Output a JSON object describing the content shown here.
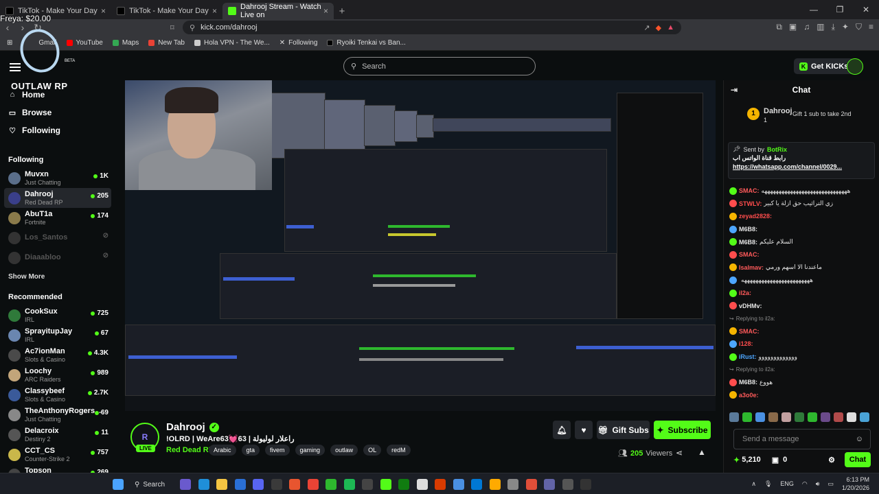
{
  "browser": {
    "tabs": [
      {
        "label": "TikTok - Make Your Day",
        "active": false
      },
      {
        "label": "TikTok - Make Your Day",
        "active": false
      },
      {
        "label": "Dahrooj Stream - Watch Live on",
        "active": true
      }
    ],
    "url": "kick.com/dahrooj",
    "overlay_text": "Freya: $20.00",
    "bookmarks": [
      "Gmail",
      "YouTube",
      "Maps",
      "New Tab",
      "Hola VPN - The We...",
      "Following",
      "Ryoiki Tenkai vs Ban..."
    ]
  },
  "logo": {
    "text": "OUTLAW RP",
    "beta": "BETA"
  },
  "header": {
    "search_placeholder": "Search",
    "get_kicks": "Get KICKs"
  },
  "sidebar": {
    "nav": [
      {
        "label": "Home",
        "icon": "home-icon"
      },
      {
        "label": "Browse",
        "icon": "browse-icon"
      },
      {
        "label": "Following",
        "icon": "heart-icon"
      }
    ],
    "following_title": "Following",
    "following": [
      {
        "name": "Muvxn",
        "category": "Just Chatting",
        "viewers": "1K",
        "online": true,
        "color": "#5a6e8a"
      },
      {
        "name": "Dahrooj",
        "category": "Red Dead RP",
        "viewers": "205",
        "online": true,
        "color": "#3a3f8a"
      },
      {
        "name": "AbuT1a",
        "category": "Fortnite",
        "viewers": "174",
        "online": true,
        "color": "#8a7a4a"
      },
      {
        "name": "Los_Santos",
        "category": "",
        "viewers": "",
        "online": false,
        "color": "#333"
      },
      {
        "name": "Diaaabloo",
        "category": "",
        "viewers": "",
        "online": false,
        "color": "#333"
      }
    ],
    "show_more": "Show More",
    "recommended_title": "Recommended",
    "recommended": [
      {
        "name": "CookSux",
        "category": "IRL",
        "viewers": "725",
        "color": "#2f7a3a"
      },
      {
        "name": "SprayitupJay",
        "category": "IRL",
        "viewers": "67",
        "color": "#6a86b0"
      },
      {
        "name": "Ac7ionMan",
        "category": "Slots & Casino",
        "viewers": "4.3K",
        "color": "#4a4a4a"
      },
      {
        "name": "Loochy",
        "category": "ARC Raiders",
        "viewers": "989",
        "color": "#c2a57a"
      },
      {
        "name": "Classybeef",
        "category": "Slots & Casino",
        "viewers": "2.7K",
        "color": "#3a5a9a"
      },
      {
        "name": "TheAnthonyRogers...",
        "category": "Just Chatting",
        "viewers": "69",
        "color": "#888"
      },
      {
        "name": "Delacroix",
        "category": "Destiny 2",
        "viewers": "11",
        "color": "#555"
      },
      {
        "name": "CCT_CS",
        "category": "Counter-Strike 2",
        "viewers": "757",
        "color": "#c9b74a"
      },
      {
        "name": "Topson",
        "category": "",
        "viewers": "269",
        "color": "#444"
      }
    ]
  },
  "stream": {
    "name": "Dahrooj",
    "title": "!OLRD | WeAre63💓63 | راعلار لوليولة",
    "category": "Red Dead RP",
    "tags": [
      "Arabic",
      "gta",
      "fivem",
      "gaming",
      "outlaw",
      "OL",
      "redM"
    ],
    "live_label": "LIVE",
    "gift_subs": "Gift Subs",
    "subscribe": "Subscribe",
    "viewers": "205",
    "viewers_label": "Viewers"
  },
  "chat": {
    "title": "Chat",
    "top_gifter": {
      "name": "Dahrooj",
      "count": "1",
      "gift_text": "Gift 1 sub to take 2nd"
    },
    "pinned": {
      "sent_by": "Sent by",
      "bot": "BotRix",
      "text": "رابط قناة الواتس اب",
      "link": "https://whatsapp.com/channel/0029..."
    },
    "messages": [
      {
        "user": "SMAC:",
        "text": "ههههههههههههههههههههههههههههههه",
        "color": "#ff5a5a",
        "reply": ""
      },
      {
        "user": "STWLV:",
        "text": "زي التراثيب حق ازلة يا كبير",
        "color": "#ff4d4d",
        "reply": ""
      },
      {
        "user": "zeyad2828:",
        "text": "",
        "color": "#ff4d4d",
        "reply": ""
      },
      {
        "user": "M6B8:",
        "text": "",
        "color": "#e6e6e6",
        "reply": ""
      },
      {
        "user": "M6B8:",
        "text": "السلام عليكم",
        "color": "#e6e6e6",
        "reply": ""
      },
      {
        "user": "SMAC:",
        "text": "",
        "color": "#ff5a5a",
        "reply": ""
      },
      {
        "user": "Isalmav:",
        "text": "ماعندنا الا اسهم ورمي",
        "color": "#ff5a5a",
        "reply": ""
      },
      {
        "user": "",
        "text": "ههههههههههههههههههههههههه",
        "color": "#e6e6e6",
        "reply": ""
      },
      {
        "user": "il2a:",
        "text": "",
        "color": "#ff5a5a",
        "reply": ""
      },
      {
        "user": "vDHMv:",
        "text": "",
        "color": "#e6e6e6",
        "reply": ""
      },
      {
        "user": "SMAC:",
        "text": "",
        "color": "#ff5a5a",
        "reply": "Replying to il2a:"
      },
      {
        "user": "i128:",
        "text": "",
        "color": "#ff4d4d",
        "reply": ""
      },
      {
        "user": "iRust:",
        "text": "ووووووووووووو",
        "color": "#4da6ff",
        "reply": ""
      },
      {
        "user": "M6B8:",
        "text": "هووع",
        "color": "#e6e6e6",
        "reply": "Replying to il2a:"
      },
      {
        "user": "a3o0e:",
        "text": "",
        "color": "#ff5a5a",
        "reply": ""
      }
    ],
    "send_placeholder": "Send a message",
    "kicks": "5,210",
    "points": "0",
    "chat_button": "Chat"
  },
  "taskbar": {
    "search": "Search",
    "lang": "ENG",
    "time": "6:13 PM",
    "date": "1/20/2026"
  }
}
